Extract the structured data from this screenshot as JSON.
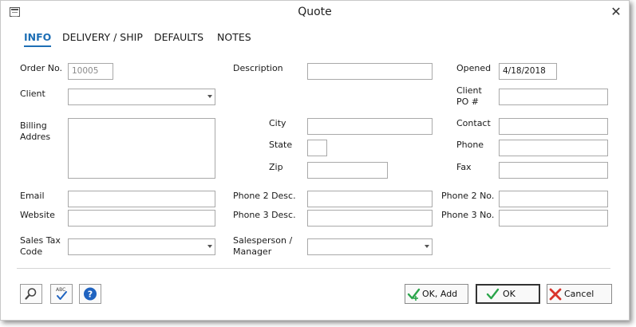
{
  "window": {
    "title": "Quote",
    "close_glyph": "✕"
  },
  "tabs": [
    {
      "label": "INFO",
      "active": true
    },
    {
      "label": "DELIVERY / SHIP",
      "active": false
    },
    {
      "label": "DEFAULTS",
      "active": false
    },
    {
      "label": "NOTES",
      "active": false
    }
  ],
  "labels": {
    "order_no": "Order No.",
    "client": "Client",
    "billing_line1": "Billing",
    "billing_line2": "Addres",
    "email": "Email",
    "website": "Website",
    "sales_tax_line1": "Sales Tax",
    "sales_tax_line2": "Code",
    "description": "Description",
    "city": "City",
    "state": "State",
    "zip": "Zip",
    "phone2_desc": "Phone 2 Desc.",
    "phone3_desc": "Phone 3 Desc.",
    "salesperson_line1": "Salesperson /",
    "salesperson_line2": "Manager",
    "opened": "Opened",
    "client_po_line1": "Client",
    "client_po_line2": "PO #",
    "contact": "Contact",
    "phone": "Phone",
    "fax": "Fax",
    "phone2_no": "Phone 2 No.",
    "phone3_no": "Phone 3 No."
  },
  "values": {
    "order_no": "10005",
    "client": "",
    "billing_address": "",
    "email": "",
    "website": "",
    "sales_tax_code": "",
    "description": "",
    "city": "",
    "state": "",
    "zip": "",
    "phone2_desc": "",
    "phone3_desc": "",
    "salesperson": "",
    "opened": "4/18/2018",
    "client_po": "",
    "contact": "",
    "phone": "",
    "fax": "",
    "phone2_no": "",
    "phone3_no": ""
  },
  "buttons": {
    "ok_add": "OK, Add",
    "ok": "OK",
    "cancel": "Cancel"
  },
  "icons": {
    "window": "app-window-icon",
    "search": "magnifier-icon",
    "spellcheck": "abc-spellcheck-icon",
    "help": "help-question-icon",
    "ok_add": "check-plus-icon",
    "ok": "checkmark-icon",
    "cancel": "red-x-icon"
  },
  "colors": {
    "accent": "#1e6fb5",
    "ok_green": "#2aa44a",
    "cancel_red": "#d9342b",
    "help_blue": "#1f63c0"
  }
}
